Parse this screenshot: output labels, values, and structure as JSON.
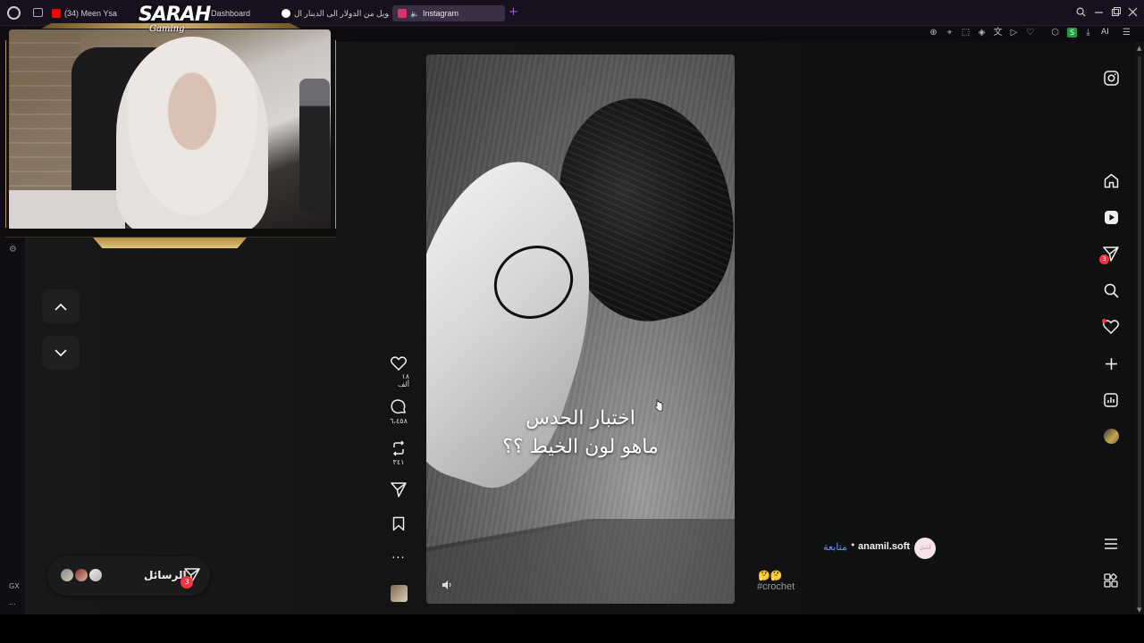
{
  "browser": {
    "tabs": [
      {
        "label": "(34) Meen Ysa",
        "favicon_color": "#ff0000"
      },
      {
        "label": "Dashboard",
        "favicon_color": "#6b4bd6"
      },
      {
        "label": "تحويل من الدولار الى الدينار ال",
        "favicon_color": "#4285f4"
      },
      {
        "label": "Instagram",
        "favicon_color": "#e1306c",
        "active": true
      }
    ],
    "new_tab": "+",
    "toolbar_ai": "AI",
    "toolbar_ext_badge": "S",
    "sidebar_gx": "GX",
    "sidebar_more": "..."
  },
  "overlay": {
    "brand": "SARAH",
    "brand_sub": "Gaming"
  },
  "reel": {
    "caption_line1": "اختبار الحدس",
    "caption_line2": "ماهو لون الخيط ؟؟",
    "likes": "١٨ ألف",
    "comments": "٦،٤٥٨",
    "reposts": "٣٤١"
  },
  "post": {
    "username": "anamil.soft",
    "follow_label": "متابعة",
    "separator": "•",
    "avatar_text": "أنامل",
    "emojis": "🤔🤔",
    "hashtag": "#crochet"
  },
  "messages": {
    "label": "الرسائل",
    "badge": "3"
  },
  "right_nav": {
    "direct_badge": "3"
  },
  "icons": [
    "instagram-icon",
    "home-icon",
    "reels-icon",
    "direct-icon",
    "search-icon",
    "heart-icon",
    "create-icon",
    "dashboard-icon",
    "more-menu-icon",
    "apps-icon"
  ]
}
